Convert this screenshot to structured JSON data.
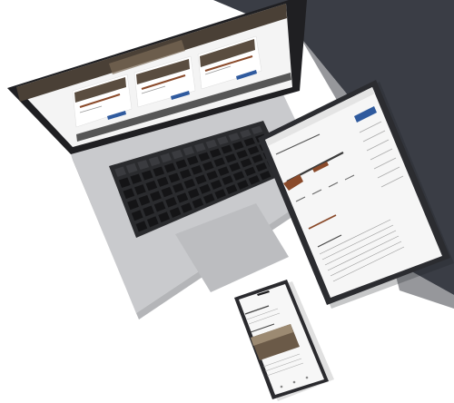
{
  "scene": {
    "description_type": "device-mockup",
    "colors": {
      "background": "#ffffff",
      "dark_panel": "#3a3d45",
      "laptop_body": "#c9cacd",
      "keyboard": "#2a2b2e",
      "key": "#1c1c1e",
      "trackpad": "#bdbec1",
      "tablet_bezel": "#2b2c30",
      "phone_bezel": "#2a2a2e",
      "screen_white": "#f6f6f6",
      "accent_blue": "#2f5a9e",
      "gun_wood": "#8a4a2a",
      "gun_metal": "#3b3b3b",
      "hero_dark": "#4a4036"
    }
  }
}
